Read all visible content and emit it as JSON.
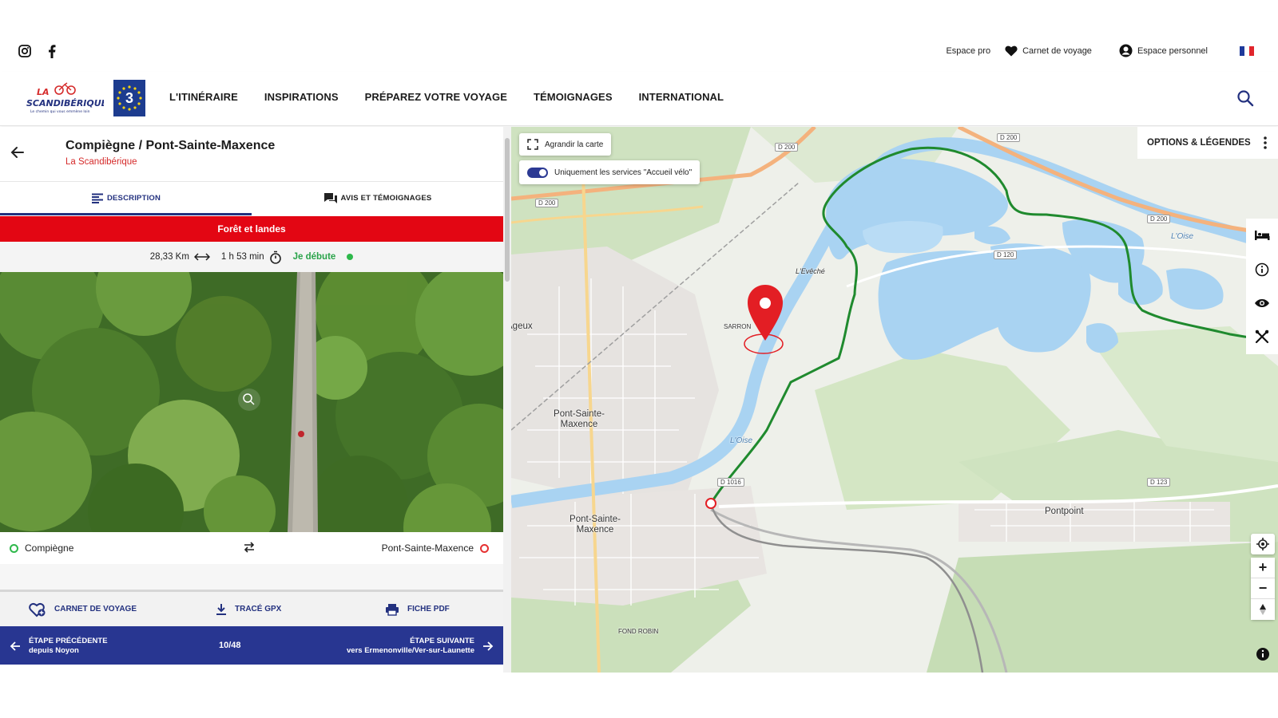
{
  "topbar": {
    "espace_pro": "Espace pro",
    "carnet": "Carnet de voyage",
    "espace_perso": "Espace personnel"
  },
  "nav": {
    "logo_line1": "LA",
    "logo_line2": "SCANDIBÉRIQUE",
    "logo_tag": "Le chemin qui vous emmène loin",
    "euro_number": "3",
    "items": [
      "L'ITINÉRAIRE",
      "INSPIRATIONS",
      "PRÉPAREZ VOTRE VOYAGE",
      "TÉMOIGNAGES",
      "INTERNATIONAL"
    ]
  },
  "stage": {
    "title": "Compiègne / Pont-Sainte-Maxence",
    "subtitle": "La Scandibérique",
    "tabs": [
      "DESCRIPTION",
      "AVIS ET TÉMOIGNAGES"
    ],
    "banner": "Forêt et landes",
    "distance": "28,33 Km",
    "duration": "1 h 53 min",
    "level": "Je débute",
    "from": "Compiègne",
    "to": "Pont-Sainte-Maxence",
    "actions": [
      "CARNET DE VOYAGE",
      "TRACÉ GPX",
      "FICHE PDF"
    ],
    "prev_label": "ÉTAPE PRÉCÉDENTE",
    "prev_place": "depuis Noyon",
    "pager": "10/48",
    "next_label": "ÉTAPE SUIVANTE",
    "next_place": "vers Ermenonville/Ver-sur-Launette"
  },
  "map": {
    "enlarge": "Agrandir la carte",
    "filter": "Uniquement les services \"Accueil vélo\"",
    "legend": "OPTIONS & LÉGENDES",
    "places": [
      "Ageux",
      "Pont-Sainte-\nMaxence",
      "Pont-Sainte-\nMaxence",
      "Pontpoint",
      "SARRON",
      "L'Evêché",
      "FOND ROBIN"
    ],
    "roads": [
      "D 200",
      "D 200",
      "D 200",
      "D 200",
      "D 1016",
      "D 123",
      "D 120"
    ],
    "rivers": [
      "L'Oise",
      "L'Oise"
    ],
    "colors": {
      "route": "#1f8a2e",
      "water": "#a9d3f2",
      "accent": "#283691",
      "marker": "#e31e24"
    }
  }
}
